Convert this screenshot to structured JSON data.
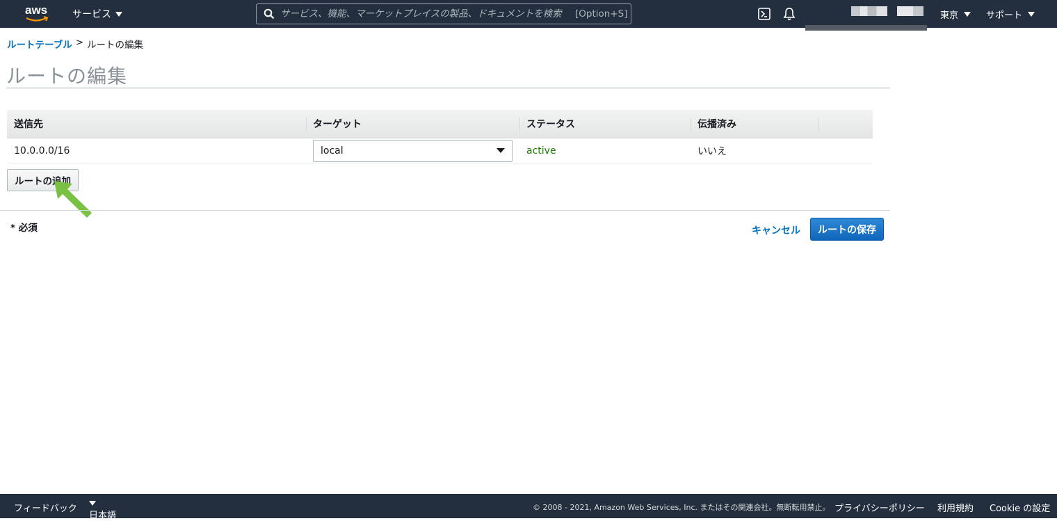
{
  "topnav": {
    "logo_text": "aws",
    "services_label": "サービス",
    "search_placeholder": "サービス、機能、マーケットプレイスの製品、ドキュメントを検索",
    "search_shortcut": "[Option+S]",
    "region_label": "東京",
    "support_label": "サポート"
  },
  "breadcrumb": {
    "parent": "ルートテーブル",
    "separator": ">",
    "current": "ルートの編集"
  },
  "page_title": "ルートの編集",
  "table": {
    "columns": [
      "送信先",
      "ターゲット",
      "ステータス",
      "伝播済み"
    ],
    "rows": [
      {
        "destination": "10.0.0.0/16",
        "target": "local",
        "status": "active",
        "propagated": "いいえ"
      }
    ]
  },
  "add_route_label": "ルートの追加",
  "required_note": "* 必須",
  "cancel_label": "キャンセル",
  "save_label": "ルートの保存",
  "colors": {
    "nav_bg": "#232f3e",
    "link": "#0073bb",
    "primary_button": "#1166bb",
    "status_active": "#1d8102",
    "annotation_arrow": "#7ac143"
  },
  "footer": {
    "feedback": "フィードバック",
    "language": "日本語",
    "copyright": "© 2008 - 2021, Amazon Web Services, Inc. またはその関連会社。無断転用禁止。",
    "privacy": "プライバシーポリシー",
    "terms": "利用規約",
    "cookie": "Cookie の設定"
  }
}
